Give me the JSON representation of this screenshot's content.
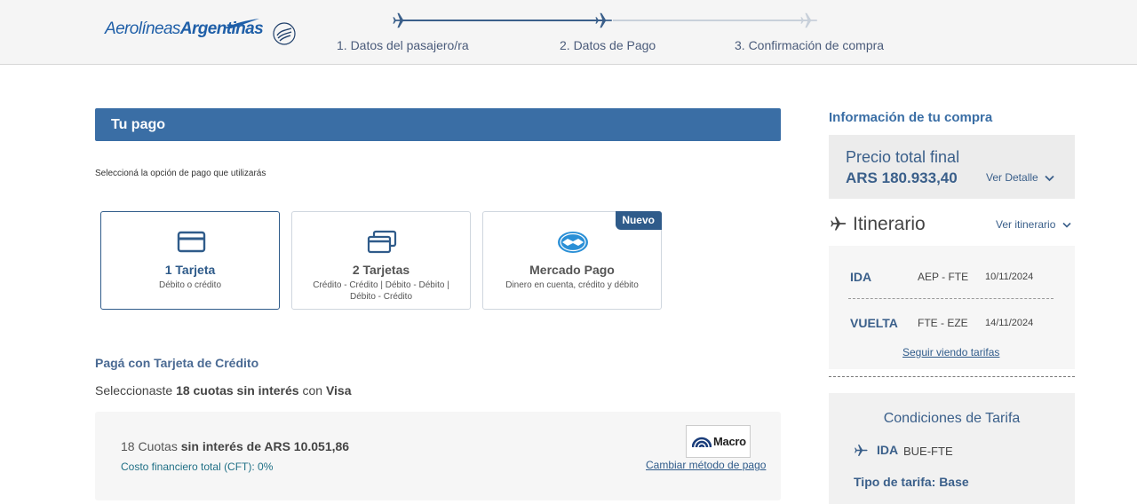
{
  "header": {
    "brand_part1": "Aerolíneas",
    "brand_part2": "Argentinas",
    "alliance_logo": "skyteam-logo-icon",
    "steps": [
      {
        "label": "1. Datos del pasajero/ra",
        "state": "done"
      },
      {
        "label": "2. Datos de Pago",
        "state": "current"
      },
      {
        "label": "3. Confirmación de compra",
        "state": "pending"
      }
    ]
  },
  "payment": {
    "section_title": "Tu pago",
    "hint": "Seleccioná la opción de pago que utilizarás",
    "options": [
      {
        "title": "1 Tarjeta",
        "subtitle": "Débito o crédito",
        "icon": "credit-card-icon",
        "selected": true
      },
      {
        "title": "2 Tarjetas",
        "subtitle": "Crédito - Crédito | Débito - Débito | Débito - Crédito",
        "icon": "two-cards-icon",
        "selected": false
      },
      {
        "title": "Mercado Pago",
        "subtitle": "Dinero en cuenta, crédito y débito",
        "icon": "mercado-pago-icon",
        "selected": false,
        "badge": "Nuevo"
      }
    ],
    "card_section_title": "Pagá con Tarjeta de Crédito",
    "selection_prefix": "Seleccionaste",
    "selection_bold": "18 cuotas sin interés",
    "selection_mid": "con",
    "selection_brand": "Visa",
    "quota_prefix": "18 Cuotas",
    "quota_bold": "sin interés de ARS 10.051,86",
    "cft": "Costo financiero total (CFT): 0%",
    "bank_name": "Macro",
    "change_method": "Cambiar método de pago"
  },
  "sidebar": {
    "info_title": "Información de tu compra",
    "price_label": "Precio total final",
    "price_value": "ARS 180.933,40",
    "ver_detalle": "Ver Detalle",
    "itinerary_title": "Itinerario",
    "ver_itinerario": "Ver itinerario",
    "legs": [
      {
        "direction": "IDA",
        "route": "AEP - FTE",
        "date": "10/11/2024"
      },
      {
        "direction": "VUELTA",
        "route": "FTE - EZE",
        "date": "14/11/2024"
      }
    ],
    "seguir": "Seguir viendo tarifas",
    "conditions_title": "Condiciones de Tarifa",
    "cond_direction": "IDA",
    "cond_route": "BUE-FTE",
    "tarifa_type": "Tipo de tarifa: Base"
  },
  "colors": {
    "brand_blue": "#3a6ea5",
    "header_bg": "#f5f5f5",
    "step_done": "#3a5f8a",
    "step_pending": "#c8d0da"
  }
}
